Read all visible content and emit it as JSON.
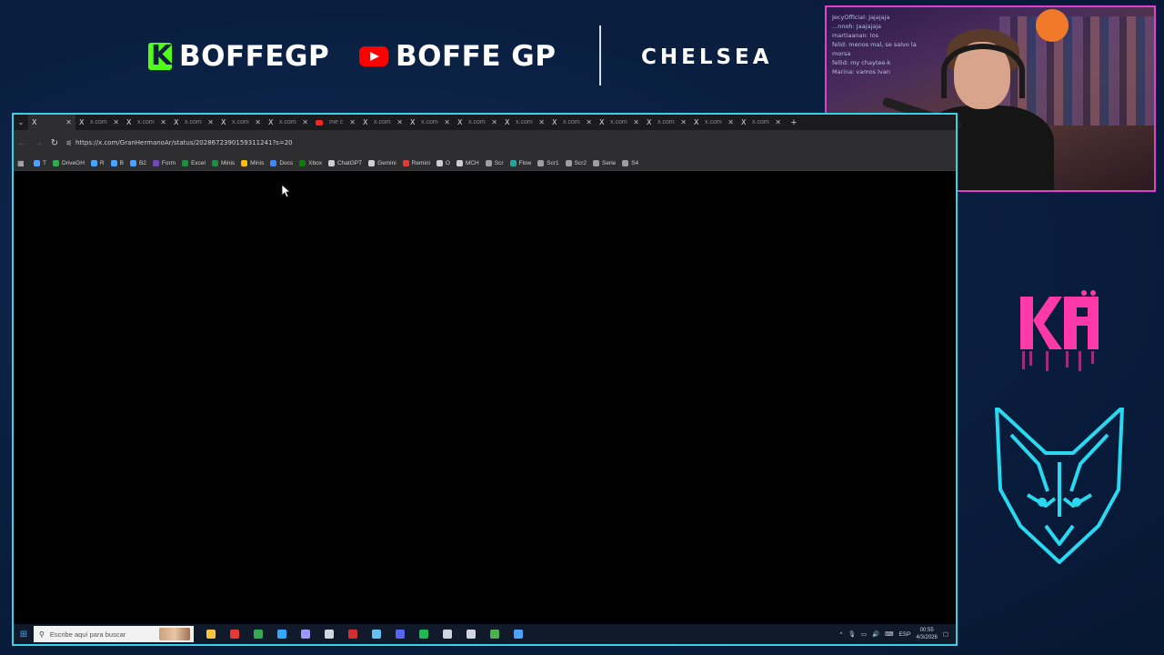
{
  "header": {
    "kick_name": "BOFFEGP",
    "youtube_name": "BOFFE GP",
    "sponsor": "CHELSEA"
  },
  "webcam": {
    "chat_lines": [
      "JecyOfficial: Jajajaja",
      "...nnoh: Jaajajaja",
      "martiaanan: los",
      "felid: menos mal, se salvo la morsa",
      "fellid: my chaytee-k",
      "Marina: vamos Ivan"
    ]
  },
  "logos": {
    "team_logo": "KRU",
    "fox_logo": "fox-emblem"
  },
  "browser": {
    "tabs": [
      {
        "label": "X",
        "active": true
      },
      {
        "label": "x.com"
      },
      {
        "label": "x.com"
      },
      {
        "label": "x.com"
      },
      {
        "label": "x.com"
      },
      {
        "label": "x.com"
      },
      {
        "label": "me c",
        "youtube": true
      },
      {
        "label": "x.com"
      },
      {
        "label": "x.com"
      },
      {
        "label": "x.com"
      },
      {
        "label": "x.com"
      },
      {
        "label": "x.com"
      },
      {
        "label": "x.com"
      },
      {
        "label": "x.com"
      },
      {
        "label": "x.com"
      },
      {
        "label": "x.com"
      },
      {
        "label": "x.com"
      }
    ],
    "new_tab_label": "+",
    "url": "https://x.com/GranHermanoAr/status/2028672390159311241?s=20",
    "bookmarks": [
      {
        "label": "T",
        "color": "#4aa3ff"
      },
      {
        "label": "DriveGH",
        "color": "#34a853"
      },
      {
        "label": "R",
        "color": "#4aa3ff"
      },
      {
        "label": "B",
        "color": "#4aa3ff"
      },
      {
        "label": "B2",
        "color": "#4aa3ff"
      },
      {
        "label": "Form",
        "color": "#7248b9"
      },
      {
        "label": "Excel",
        "color": "#1e8e3e"
      },
      {
        "label": "Minis",
        "color": "#1e8e3e"
      },
      {
        "label": "Minis",
        "color": "#fbbc04"
      },
      {
        "label": "Docs",
        "color": "#4285f4"
      },
      {
        "label": "Xbox",
        "color": "#107c10"
      },
      {
        "label": "ChatGPT",
        "color": "#cfcfcf"
      },
      {
        "label": "Gemini",
        "color": "#cfcfcf"
      },
      {
        "label": "Remini",
        "color": "#e53935"
      },
      {
        "label": "O",
        "color": "#cfcfcf"
      },
      {
        "label": "MCH",
        "color": "#cfcfcf"
      },
      {
        "label": "Scr",
        "color": "#9e9e9e"
      },
      {
        "label": "Flow",
        "color": "#26a69a"
      },
      {
        "label": "Scr1",
        "color": "#9e9e9e"
      },
      {
        "label": "Scr2",
        "color": "#9e9e9e"
      },
      {
        "label": "Serie",
        "color": "#9e9e9e"
      },
      {
        "label": "S4",
        "color": "#9e9e9e"
      }
    ]
  },
  "taskbar": {
    "search_placeholder": "Escribe aquí para buscar",
    "apps": [
      {
        "name": "file-explorer",
        "color": "#f5c542"
      },
      {
        "name": "app-red-circle",
        "color": "#e53935"
      },
      {
        "name": "chrome",
        "color": "#34a853"
      },
      {
        "name": "photoshop",
        "color": "#31a8ff"
      },
      {
        "name": "premiere",
        "color": "#9999ff"
      },
      {
        "name": "calculator",
        "color": "#cfd6e0"
      },
      {
        "name": "app-red",
        "color": "#d32f2f"
      },
      {
        "name": "steam",
        "color": "#66c0f4"
      },
      {
        "name": "discord",
        "color": "#5865f2"
      },
      {
        "name": "spotify",
        "color": "#1db954"
      },
      {
        "name": "obs",
        "color": "#cfd6e0"
      },
      {
        "name": "app-gear",
        "color": "#cfd6e0"
      },
      {
        "name": "app-green",
        "color": "#4caf50"
      },
      {
        "name": "app-blue",
        "color": "#4aa3ff"
      }
    ],
    "language": "ESP",
    "time": "00:55",
    "date": "4/3/2026"
  }
}
